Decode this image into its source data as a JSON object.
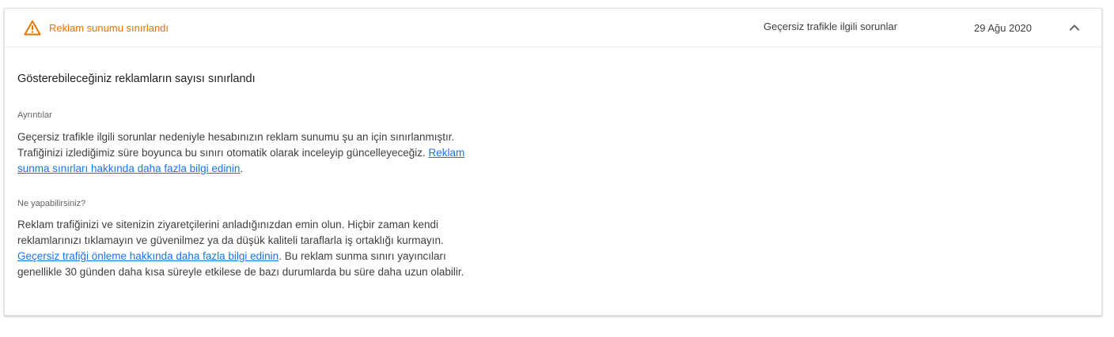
{
  "header": {
    "status_icon": "warning-triangle-icon",
    "status_label": "Reklam sunumu sınırlandı",
    "reason": "Geçersiz trafikle ilgili sorunlar",
    "date": "29 Ağu 2020",
    "toggle_icon": "chevron-up-icon"
  },
  "colors": {
    "warning": "#e37400",
    "link": "#1a73e8"
  },
  "content": {
    "title": "Gösterebileceğiniz reklamların sayısı sınırlandı",
    "details": {
      "label": "Ayrıntılar",
      "text_before_link": "Geçersiz trafikle ilgili sorunlar nedeniyle hesabınızın reklam sunumu şu an için sınırlanmıştır. Trafiğinizi izlediğimiz süre boyunca bu sınırı otomatik olarak inceleyip güncelleyeceğiz. ",
      "link": "Reklam sunma sınırları hakkında daha fazla bilgi edinin",
      "text_after_link": "."
    },
    "actions": {
      "label": "Ne yapabilirsiniz?",
      "text_before_link": "Reklam trafiğinizi ve sitenizin ziyaretçilerini anladığınızdan emin olun. Hiçbir zaman kendi reklamlarınızı tıklamayın ve güvenilmez ya da düşük kaliteli taraflarla iş ortaklığı kurmayın. ",
      "link": "Geçersiz trafiği önleme hakkında daha fazla bilgi edinin",
      "text_after_link": ". Bu reklam sunma sınırı yayıncıları genellikle 30 günden daha kısa süreyle etkilese de bazı durumlarda bu süre daha uzun olabilir."
    }
  }
}
